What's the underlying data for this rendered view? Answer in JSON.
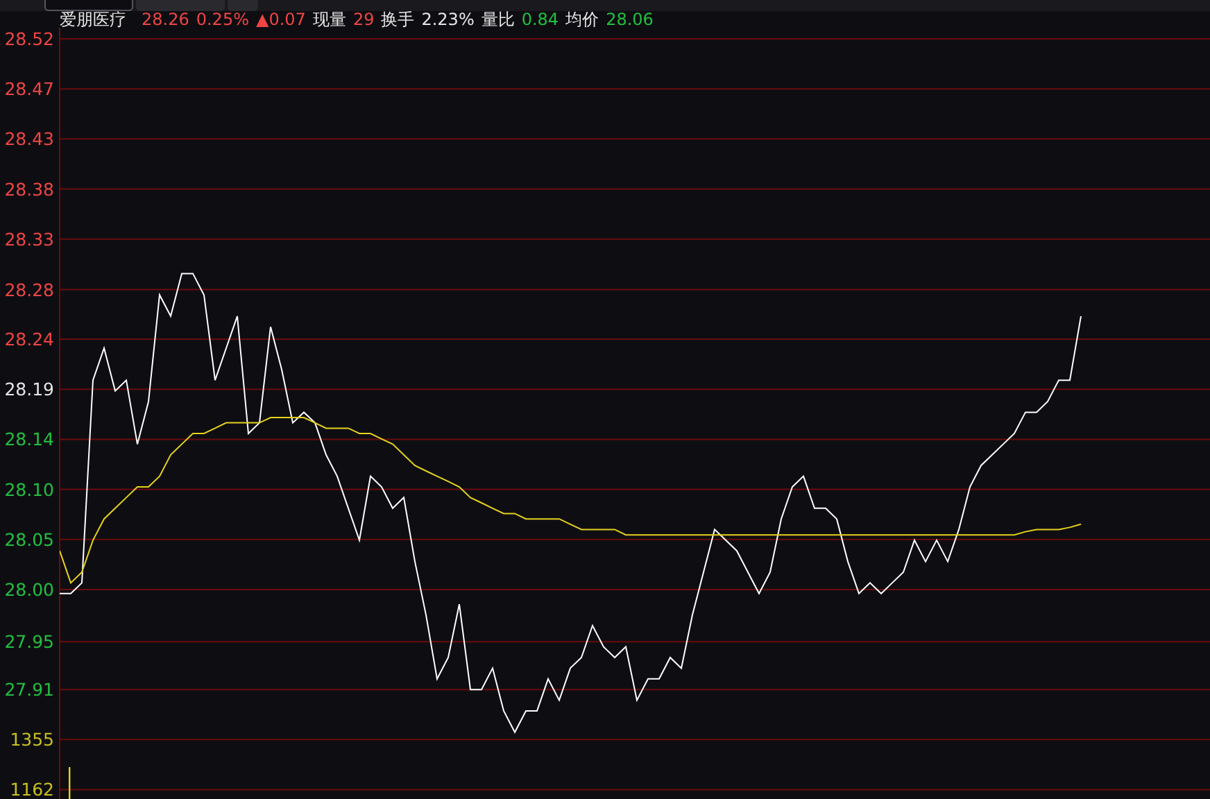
{
  "tabs": [
    {
      "selected": true
    },
    {
      "selected": false
    },
    {
      "selected": false
    }
  ],
  "quote": {
    "name": "爱朋医疗",
    "fields": [
      {
        "text": "28.26",
        "color": "#f04545"
      },
      {
        "text": "0.25%",
        "color": "#f04545"
      },
      {
        "text": "▲0.07",
        "color": "#f04545"
      },
      {
        "text": "现量",
        "color": "#e6e6e6"
      },
      {
        "text": "29",
        "color": "#f04545"
      },
      {
        "text": "换手",
        "color": "#e6e6e6"
      },
      {
        "text": "2.23%",
        "color": "#e6e6e6"
      },
      {
        "text": "量比",
        "color": "#e6e6e6"
      },
      {
        "text": "0.84",
        "color": "#22c040"
      },
      {
        "text": "均价",
        "color": "#e6e6e6"
      },
      {
        "text": "28.06",
        "color": "#22c040"
      }
    ]
  },
  "price_axis": [
    {
      "color": "#f04545"
    },
    {
      "color": "#f04545"
    },
    {
      "color": "#f04545"
    },
    {
      "color": "#f04545"
    },
    {
      "color": "#f04545"
    },
    {
      "color": "#f04545"
    },
    {
      "color": "#f04545"
    },
    {
      "color": "#e6e6e6"
    },
    {
      "color": "#22c040"
    },
    {
      "color": "#22c040"
    },
    {
      "color": "#22c040"
    },
    {
      "color": "#22c040"
    },
    {
      "color": "#22c040"
    },
    {
      "color": "#22c040"
    }
  ],
  "volume_axis": [
    {
      "label": "1355"
    },
    {
      "label": "1162"
    }
  ],
  "chart_data": {
    "type": "line",
    "grid": true,
    "ylim": [
      27.81,
      28.52
    ],
    "yticks": [
      {
        "value": 28.52,
        "label": "28.52"
      },
      {
        "value": 28.4731,
        "label": "28.47"
      },
      {
        "value": 28.4262,
        "label": "28.43"
      },
      {
        "value": 28.3792,
        "label": "28.38"
      },
      {
        "value": 28.3323,
        "label": "28.33"
      },
      {
        "value": 28.2849,
        "label": "28.28"
      },
      {
        "value": 28.2385,
        "label": "28.24"
      },
      {
        "value": 28.1915,
        "label": "28.19"
      },
      {
        "value": 28.1446,
        "label": "28.14"
      },
      {
        "value": 28.0977,
        "label": "28.10"
      },
      {
        "value": 28.0508,
        "label": "28.05"
      },
      {
        "value": 28.0038,
        "label": "28.00"
      },
      {
        "value": 27.9549,
        "label": "27.95"
      },
      {
        "value": 27.91,
        "label": "27.91"
      }
    ],
    "series": [
      {
        "color": "#ffffff",
        "values": [
          28.0,
          28.0,
          28.01,
          28.2,
          28.23,
          28.19,
          28.2,
          28.14,
          28.18,
          28.28,
          28.26,
          28.3,
          28.3,
          28.28,
          28.2,
          28.23,
          28.26,
          28.15,
          28.16,
          28.25,
          28.21,
          28.16,
          28.17,
          28.16,
          28.13,
          28.11,
          28.08,
          28.05,
          28.11,
          28.1,
          28.08,
          28.09,
          28.03,
          27.98,
          27.92,
          27.94,
          27.99,
          27.91,
          27.91,
          27.93,
          27.89,
          27.87,
          27.89,
          27.89,
          27.92,
          27.9,
          27.93,
          27.94,
          27.97,
          27.95,
          27.94,
          27.95,
          27.9,
          27.92,
          27.92,
          27.94,
          27.93,
          27.98,
          28.02,
          28.06,
          28.05,
          28.04,
          28.02,
          28.0,
          28.02,
          28.07,
          28.1,
          28.11,
          28.08,
          28.08,
          28.07,
          28.03,
          28.0,
          28.01,
          28.0,
          28.01,
          28.02,
          28.05,
          28.03,
          28.05,
          28.03,
          28.06,
          28.1,
          28.12,
          28.13,
          28.14,
          28.15,
          28.17,
          28.17,
          28.18,
          28.2,
          28.2,
          28.26
        ]
      },
      {
        "color": "#e6d21e",
        "values": [
          28.04,
          28.01,
          28.02,
          28.05,
          28.07,
          28.08,
          28.09,
          28.1,
          28.1,
          28.11,
          28.13,
          28.14,
          28.15,
          28.15,
          28.155,
          28.16,
          28.16,
          28.16,
          28.16,
          28.165,
          28.165,
          28.165,
          28.165,
          28.16,
          28.155,
          28.155,
          28.155,
          28.15,
          28.15,
          28.145,
          28.14,
          28.13,
          28.12,
          28.115,
          28.11,
          28.105,
          28.1,
          28.09,
          28.085,
          28.08,
          28.075,
          28.075,
          28.07,
          28.07,
          28.07,
          28.07,
          28.065,
          28.06,
          28.06,
          28.06,
          28.06,
          28.055,
          28.055,
          28.055,
          28.055,
          28.055,
          28.055,
          28.055,
          28.055,
          28.055,
          28.055,
          28.055,
          28.055,
          28.055,
          28.055,
          28.055,
          28.055,
          28.055,
          28.055,
          28.055,
          28.055,
          28.055,
          28.055,
          28.055,
          28.055,
          28.055,
          28.055,
          28.055,
          28.055,
          28.055,
          28.055,
          28.055,
          28.055,
          28.055,
          28.055,
          28.055,
          28.055,
          28.058,
          28.06,
          28.06,
          28.06,
          28.062,
          28.065
        ]
      }
    ]
  }
}
